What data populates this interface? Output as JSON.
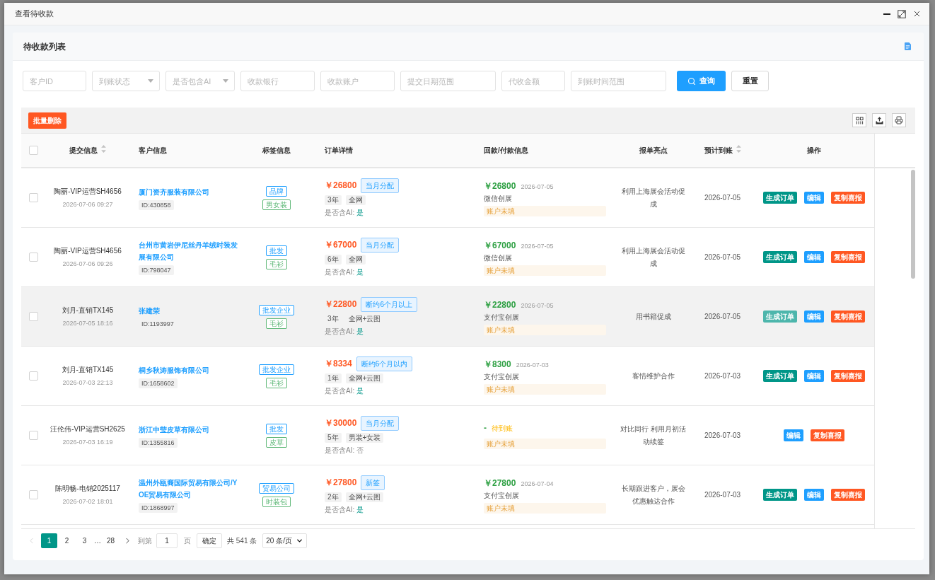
{
  "window": {
    "title": "查看待收款"
  },
  "card": {
    "title": "待收款列表"
  },
  "filters": [
    {
      "kind": "text",
      "placeholder": "客户ID"
    },
    {
      "kind": "select",
      "placeholder": "到账状态"
    },
    {
      "kind": "select",
      "placeholder": "是否包含AI"
    },
    {
      "kind": "text",
      "placeholder": "收款银行"
    },
    {
      "kind": "text",
      "placeholder": "收款账户"
    },
    {
      "kind": "text",
      "placeholder": "提交日期范围"
    },
    {
      "kind": "text",
      "placeholder": "代收金额"
    },
    {
      "kind": "text",
      "placeholder": "到账时间范围"
    }
  ],
  "filter_buttons": [
    {
      "kind": "search",
      "label": "查询"
    },
    {
      "kind": "reset",
      "label": "重置"
    }
  ],
  "toolbar": {
    "batch_delete": "批量删除"
  },
  "table": {
    "select_all": {
      "checked": false
    },
    "columns": [
      {
        "label": "提交信息",
        "kind": "sortable"
      },
      {
        "label": "客户信息",
        "kind": "plain"
      },
      {
        "label": "标签信息",
        "kind": "plain"
      },
      {
        "label": "订单详情",
        "kind": "plain"
      },
      {
        "label": "回款/付款信息",
        "kind": "plain"
      },
      {
        "label": "报单亮点",
        "kind": "plain"
      },
      {
        "label": "预计到账",
        "kind": "sortable"
      },
      {
        "label": "操作",
        "kind": "plain"
      }
    ],
    "rows": [
      {
        "checked": false,
        "hovered": false,
        "submitter": "陶丽-VIP运营SH4656",
        "submitted_at": "2026-07-06 09:27",
        "customer": {
          "name": "厦门资齐服装有限公司",
          "id": "ID:430858"
        },
        "tags": [
          {
            "label": "品牌",
            "color": "#1e9fff"
          },
          {
            "label": "男女装",
            "color": "#5fb878"
          }
        ],
        "order": {
          "amount": "￥26800",
          "type": "当月分配",
          "chips": [
            "3年",
            "全网"
          ],
          "ai_label": "是否含AI:",
          "ai_value": "是",
          "ai_included": true
        },
        "payment": {
          "kind": "received",
          "amount": "￥26800",
          "date": "2026-07-05",
          "channel": "微信创展",
          "account_note": "账户未填"
        },
        "highlight": "利用上海展会活动促成",
        "expected_date": "2026-07-05",
        "actions": [
          {
            "kind": "generate",
            "label": "生成订单"
          },
          {
            "kind": "edit",
            "label": "编辑"
          },
          {
            "kind": "copy",
            "label": "复制喜报"
          }
        ]
      },
      {
        "checked": false,
        "hovered": false,
        "submitter": "陶丽-VIP运营SH4656",
        "submitted_at": "2026-07-06 09:26",
        "customer": {
          "name": "台州市黄岩伊尼丝丹羊绒时装发展有限公司",
          "id": "ID:798047"
        },
        "tags": [
          {
            "label": "批发",
            "color": "#1e9fff"
          },
          {
            "label": "毛衫",
            "color": "#5fb878"
          }
        ],
        "order": {
          "amount": "￥67000",
          "type": "当月分配",
          "chips": [
            "6年",
            "全网"
          ],
          "ai_label": "是否含AI:",
          "ai_value": "是",
          "ai_included": true
        },
        "payment": {
          "kind": "received",
          "amount": "￥67000",
          "date": "2026-07-05",
          "channel": "微信创展",
          "account_note": "账户未填"
        },
        "highlight": "利用上海展会活动促成",
        "expected_date": "2026-07-05",
        "actions": [
          {
            "kind": "generate",
            "label": "生成订单"
          },
          {
            "kind": "edit",
            "label": "编辑"
          },
          {
            "kind": "copy",
            "label": "复制喜报"
          }
        ]
      },
      {
        "checked": false,
        "hovered": true,
        "submitter": "刘月-直销TX145",
        "submitted_at": "2026-07-05 18:16",
        "customer": {
          "name": "张建荣",
          "id": "ID:1193997"
        },
        "tags": [
          {
            "label": "批发企业",
            "color": "#1e9fff"
          },
          {
            "label": "毛衫",
            "color": "#5fb878"
          }
        ],
        "order": {
          "amount": "￥22800",
          "type": "断约6个月以上",
          "chips": [
            "3年",
            "全网+云图"
          ],
          "ai_label": "是否含AI:",
          "ai_value": "是",
          "ai_included": true
        },
        "payment": {
          "kind": "received",
          "amount": "￥22800",
          "date": "2026-07-05",
          "channel": "支付宝创展",
          "account_note": "账户未填"
        },
        "highlight": "用书籍促成",
        "expected_date": "2026-07-05",
        "actions": [
          {
            "kind": "generate",
            "label": "生成订单"
          },
          {
            "kind": "edit",
            "label": "编辑"
          },
          {
            "kind": "copy",
            "label": "复制喜报"
          }
        ]
      },
      {
        "checked": false,
        "hovered": false,
        "submitter": "刘月-直销TX145",
        "submitted_at": "2026-07-03 22:13",
        "customer": {
          "name": "桐乡秋涛服饰有限公司",
          "id": "ID:1658602"
        },
        "tags": [
          {
            "label": "批发企业",
            "color": "#1e9fff"
          },
          {
            "label": "毛衫",
            "color": "#5fb878"
          }
        ],
        "order": {
          "amount": "￥8334",
          "type": "断约6个月以内",
          "chips": [
            "1年",
            "全网+云图"
          ],
          "ai_label": "是否含AI:",
          "ai_value": "是",
          "ai_included": true
        },
        "payment": {
          "kind": "received",
          "amount": "￥8300",
          "date": "2026-07-03",
          "channel": "支付宝创展",
          "account_note": "账户未填"
        },
        "highlight": "客情维护合作",
        "expected_date": "2026-07-03",
        "actions": [
          {
            "kind": "generate",
            "label": "生成订单"
          },
          {
            "kind": "edit",
            "label": "编辑"
          },
          {
            "kind": "copy",
            "label": "复制喜报"
          }
        ]
      },
      {
        "checked": false,
        "hovered": false,
        "submitter": "汪伦伟-VIP运营SH2625",
        "submitted_at": "2026-07-03 16:19",
        "customer": {
          "name": "浙江中莹皮草有限公司",
          "id": "ID:1355816"
        },
        "tags": [
          {
            "label": "批发",
            "color": "#1e9fff"
          },
          {
            "label": "皮草",
            "color": "#5fb878"
          }
        ],
        "order": {
          "amount": "￥30000",
          "type": "当月分配",
          "chips": [
            "5年",
            "男装+女装"
          ],
          "ai_label": "是否含AI:",
          "ai_value": "否",
          "ai_included": false
        },
        "payment": {
          "kind": "pending",
          "amount": "-",
          "note": "待到账",
          "account_note": "账户未填"
        },
        "highlight": "对比同行 利用月初活动续签",
        "expected_date": "2026-07-03",
        "actions": [
          {
            "kind": "edit",
            "label": "编辑"
          },
          {
            "kind": "copy",
            "label": "复制喜报"
          }
        ]
      },
      {
        "checked": false,
        "hovered": false,
        "submitter": "陈明畅-电销2025117",
        "submitted_at": "2026-07-02 18:01",
        "customer": {
          "name": "温州外瓯裔国际贸易有限公司/YOE贸易有限公司",
          "id": "ID:1868997"
        },
        "tags": [
          {
            "label": "贸易公司",
            "color": "#1e9fff"
          },
          {
            "label": "时装包",
            "color": "#5fb878"
          }
        ],
        "order": {
          "amount": "￥27800",
          "type": "新签",
          "chips": [
            "2年",
            "全网+云图"
          ],
          "ai_label": "是否含AI:",
          "ai_value": "是",
          "ai_included": true
        },
        "payment": {
          "kind": "received",
          "amount": "￥27800",
          "date": "2026-07-04",
          "channel": "支付宝创展",
          "account_note": "账户未填"
        },
        "highlight": "长期跟进客户，展会优惠触达合作",
        "expected_date": "2026-07-03",
        "actions": [
          {
            "kind": "generate",
            "label": "生成订单"
          },
          {
            "kind": "edit",
            "label": "编辑"
          },
          {
            "kind": "copy",
            "label": "复制喜报"
          }
        ]
      }
    ]
  },
  "pagination": {
    "prev": {
      "disabled": true
    },
    "pages": [
      {
        "kind": "page",
        "label": "1",
        "selected": true
      },
      {
        "kind": "page",
        "label": "2",
        "selected": false
      },
      {
        "kind": "page",
        "label": "3",
        "selected": false
      },
      {
        "kind": "ellipsis",
        "label": "…"
      },
      {
        "kind": "page",
        "label": "28",
        "selected": false
      }
    ],
    "next": {
      "disabled": false
    },
    "jump_before": "到第",
    "jump_value": "1",
    "jump_after": "页",
    "jump_button": "确定",
    "total": "共 541 条",
    "page_size": "20 条/页"
  }
}
